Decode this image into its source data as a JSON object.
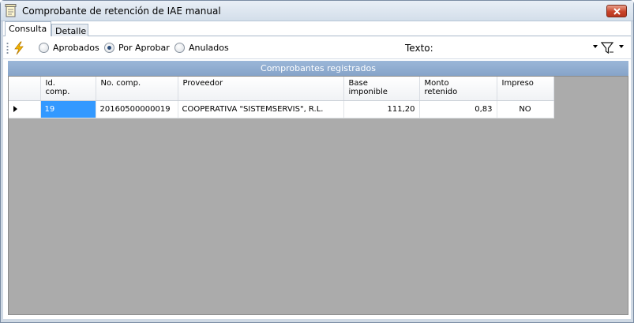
{
  "window": {
    "title": "Comprobante de retención de IAE manual"
  },
  "tabs": [
    {
      "label": "Consulta"
    },
    {
      "label": "Detalle"
    }
  ],
  "toolbar": {
    "filters": [
      {
        "label": "Aprobados",
        "checked": false
      },
      {
        "label": "Por Aprobar",
        "checked": true
      },
      {
        "label": "Anulados",
        "checked": false
      }
    ],
    "texto_label": "Texto:",
    "texto_value": ""
  },
  "grid": {
    "caption": "Comprobantes registrados",
    "columns": [
      {
        "line1": "Id.",
        "line2": "comp."
      },
      {
        "line1": "No. comp.",
        "line2": ""
      },
      {
        "line1": "Proveedor",
        "line2": ""
      },
      {
        "line1": "Base",
        "line2": "imponible"
      },
      {
        "line1": "Monto",
        "line2": "retenido"
      },
      {
        "line1": "Impreso",
        "line2": ""
      }
    ],
    "rows": [
      {
        "id": "19",
        "no_comp": "20160500000019",
        "proveedor": "COOPERATIVA \"SISTEMSERVIS\", R.L.",
        "base": "111,20",
        "monto": "0,83",
        "impreso": "NO"
      }
    ]
  },
  "colors": {
    "caption_bar": "#8fadd1",
    "grid_background": "#ababab",
    "selected_cell": "#3399ff"
  }
}
